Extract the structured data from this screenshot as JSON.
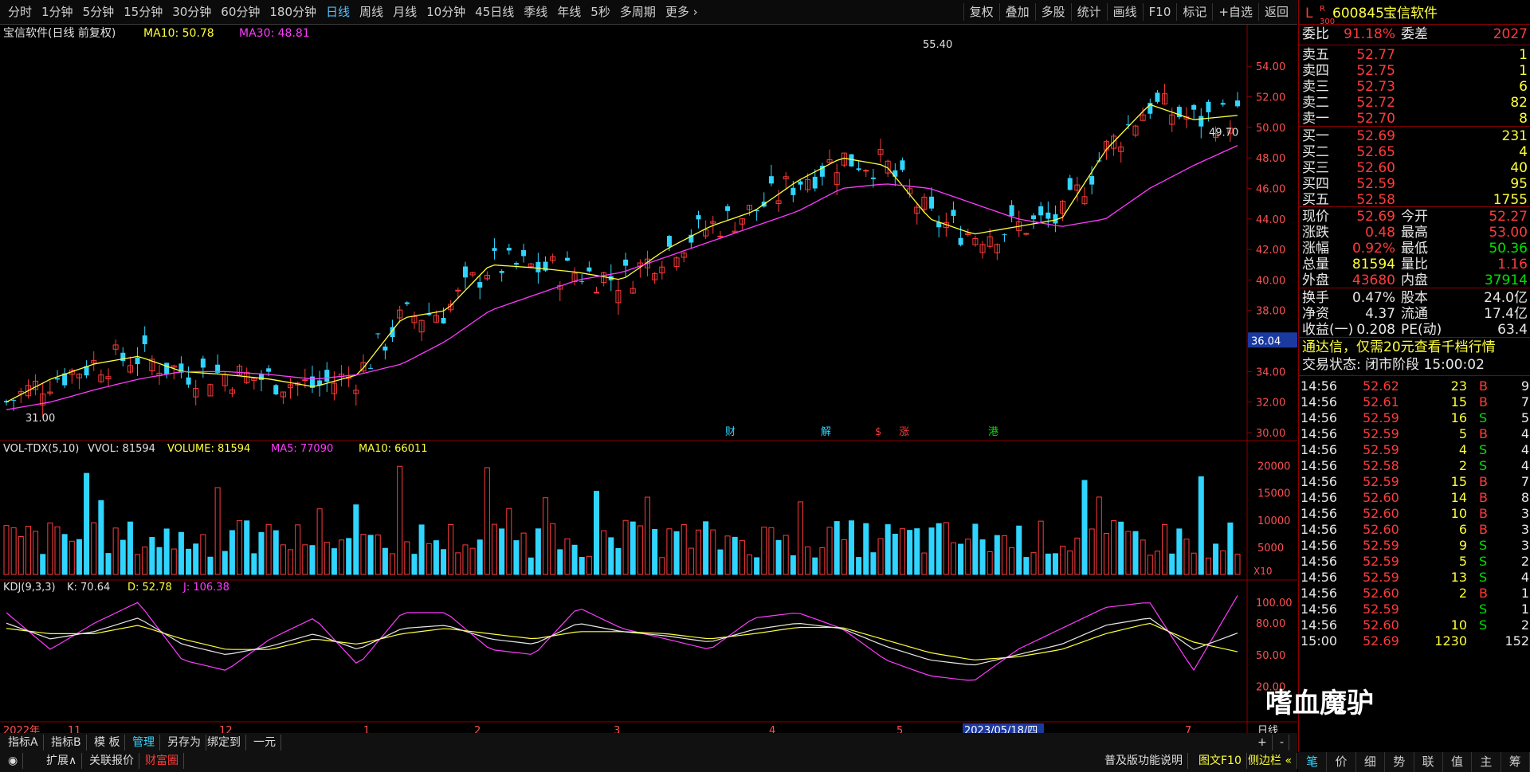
{
  "toolbar": {
    "periods": [
      "分时",
      "1分钟",
      "5分钟",
      "15分钟",
      "30分钟",
      "60分钟",
      "180分钟",
      "日线",
      "周线",
      "月线",
      "10分钟",
      "45日线",
      "季线",
      "年线",
      "5秒",
      "多周期",
      "更多 ›"
    ],
    "active_period": "日线",
    "tools": [
      "复权",
      "叠加",
      "多股",
      "统计",
      "画线",
      "F10",
      "标记",
      "+自选",
      "返回"
    ]
  },
  "main_chart": {
    "title": "宝信软件(日线 前复权)",
    "ma10_label": "MA10: 50.78",
    "ma30_label": "MA30: 48.81",
    "high_marker": "55.40",
    "low_marker": "31.00",
    "price_marker": "49.70",
    "current_tag": "36.04",
    "y_ticks": [
      "54.00",
      "52.00",
      "50.00",
      "48.00",
      "46.00",
      "44.00",
      "42.00",
      "40.00",
      "38.00",
      "36.00",
      "34.00",
      "32.00",
      "30.00"
    ],
    "event_tags": [
      {
        "text": "财",
        "color": "#30d5ff"
      },
      {
        "text": "解",
        "color": "#30d5ff"
      },
      {
        "text": "$",
        "color": "#ff3b3b"
      },
      {
        "text": "涨",
        "color": "#ff3b3b"
      },
      {
        "text": "港",
        "color": "#00e100"
      }
    ]
  },
  "vol_panel": {
    "name": "VOL-TDX(5,10)",
    "vvol": "VVOL: 81594",
    "volume": "VOLUME: 81594",
    "ma5": "MA5: 77090",
    "ma10": "MA10: 66011",
    "y_ticks": [
      "20000",
      "15000",
      "10000",
      "5000"
    ],
    "unit": "X10"
  },
  "kdj_panel": {
    "name": "KDJ(9,3,3)",
    "k": "K: 70.64",
    "d": "D: 52.78",
    "j": "J: 106.38",
    "y_ticks": [
      "100.00",
      "80.00",
      "50.00",
      "20.00"
    ]
  },
  "x_axis": {
    "labels": [
      "2022年",
      "11",
      "12",
      "1",
      "2",
      "3",
      "4",
      "5",
      "2023/05/18/四",
      "7"
    ],
    "period_label": "日线"
  },
  "bottom": {
    "tabs1": [
      "指标A",
      "指标B",
      "模 板",
      "管理",
      "另存为",
      "绑定到",
      "一元"
    ],
    "tabs2": [
      "扩展∧",
      "关联报价",
      "财富圈"
    ],
    "right_links": [
      "普及版功能说明",
      "图文F10",
      "侧边栏 «"
    ],
    "plus": "+",
    "minus": "-"
  },
  "quote": {
    "code": "600845",
    "name": "宝信软件",
    "badge_l": "L",
    "badge_r": "R",
    "badge_num": "300",
    "weibi_label": "委比",
    "weibi": "91.18%",
    "weicha_label": "委差",
    "weicha": "2027",
    "asks": [
      {
        "label": "卖五",
        "price": "52.77",
        "vol": "1"
      },
      {
        "label": "卖四",
        "price": "52.75",
        "vol": "1"
      },
      {
        "label": "卖三",
        "price": "52.73",
        "vol": "6"
      },
      {
        "label": "卖二",
        "price": "52.72",
        "vol": "82"
      },
      {
        "label": "卖一",
        "price": "52.70",
        "vol": "8"
      }
    ],
    "bids": [
      {
        "label": "买一",
        "price": "52.69",
        "vol": "231"
      },
      {
        "label": "买二",
        "price": "52.65",
        "vol": "4"
      },
      {
        "label": "买三",
        "price": "52.60",
        "vol": "40"
      },
      {
        "label": "买四",
        "price": "52.59",
        "vol": "95"
      },
      {
        "label": "买五",
        "price": "52.58",
        "vol": "1755"
      }
    ],
    "stats": [
      {
        "l1": "现价",
        "v1": "52.69",
        "c1": "red",
        "l2": "今开",
        "v2": "52.27",
        "c2": "red"
      },
      {
        "l1": "涨跌",
        "v1": "0.48",
        "c1": "red",
        "l2": "最高",
        "v2": "53.00",
        "c2": "red"
      },
      {
        "l1": "涨幅",
        "v1": "0.92%",
        "c1": "red",
        "l2": "最低",
        "v2": "50.36",
        "c2": "green"
      },
      {
        "l1": "总量",
        "v1": "81594",
        "c1": "yellow",
        "l2": "量比",
        "v2": "1.16",
        "c2": "red"
      },
      {
        "l1": "外盘",
        "v1": "43680",
        "c1": "red",
        "l2": "内盘",
        "v2": "37914",
        "c2": "green"
      }
    ],
    "stats2": [
      {
        "l1": "换手",
        "v1": "0.47%",
        "l2": "股本",
        "v2": "24.0亿"
      },
      {
        "l1": "净资",
        "v1": "4.37",
        "l2": "流通",
        "v2": "17.4亿"
      },
      {
        "l1": "收益(一)",
        "v1": "0.208",
        "l2": "PE(动)",
        "v2": "63.4"
      }
    ],
    "promo": "通达信，仅需20元查看千档行情",
    "status": "交易状态: 闭市阶段 15:00:02"
  },
  "trades": [
    {
      "t": "14:56",
      "p": "52.62",
      "v": "23",
      "s": "B",
      "n": "9"
    },
    {
      "t": "14:56",
      "p": "52.61",
      "v": "15",
      "s": "B",
      "n": "7"
    },
    {
      "t": "14:56",
      "p": "52.59",
      "v": "16",
      "s": "S",
      "n": "5"
    },
    {
      "t": "14:56",
      "p": "52.59",
      "v": "5",
      "s": "B",
      "n": "4"
    },
    {
      "t": "14:56",
      "p": "52.59",
      "v": "4",
      "s": "S",
      "n": "4"
    },
    {
      "t": "14:56",
      "p": "52.58",
      "v": "2",
      "s": "S",
      "n": "4"
    },
    {
      "t": "14:56",
      "p": "52.59",
      "v": "15",
      "s": "B",
      "n": "7"
    },
    {
      "t": "14:56",
      "p": "52.60",
      "v": "14",
      "s": "B",
      "n": "8"
    },
    {
      "t": "14:56",
      "p": "52.60",
      "v": "10",
      "s": "B",
      "n": "3"
    },
    {
      "t": "14:56",
      "p": "52.60",
      "v": "6",
      "s": "B",
      "n": "3"
    },
    {
      "t": "14:56",
      "p": "52.59",
      "v": "9",
      "s": "S",
      "n": "3"
    },
    {
      "t": "14:56",
      "p": "52.59",
      "v": "5",
      "s": "S",
      "n": "2"
    },
    {
      "t": "14:56",
      "p": "52.59",
      "v": "13",
      "s": "S",
      "n": "4"
    },
    {
      "t": "14:56",
      "p": "52.60",
      "v": "2",
      "s": "B",
      "n": "1"
    },
    {
      "t": "14:56",
      "p": "52.59",
      "v": "",
      "s": "S",
      "n": "1"
    },
    {
      "t": "14:56",
      "p": "52.60",
      "v": "10",
      "s": "S",
      "n": "2"
    },
    {
      "t": "15:00",
      "p": "52.69",
      "v": "1230",
      "s": "",
      "n": "152"
    }
  ],
  "right_tabs": [
    "笔",
    "价",
    "细",
    "势",
    "联",
    "值",
    "主",
    "筹"
  ],
  "watermark": "嗜血魔驴",
  "chart_data": {
    "type": "line",
    "title": "宝信软件(日线 前复权)",
    "series": [
      {
        "name": "MA10",
        "values": [
          32.0,
          33.5,
          34.5,
          35.0,
          34.0,
          33.8,
          33.5,
          33.0,
          33.8,
          37.5,
          38.0,
          41.0,
          40.8,
          40.5,
          40.0,
          42.0,
          43.5,
          44.5,
          46.5,
          48.0,
          47.5,
          44.0,
          43.0,
          43.5,
          44.0,
          48.5,
          51.5,
          50.5,
          50.78
        ]
      },
      {
        "name": "MA30",
        "values": [
          31.5,
          32.0,
          32.8,
          33.5,
          34.0,
          34.0,
          33.8,
          33.5,
          33.8,
          34.5,
          36.0,
          38.0,
          39.0,
          40.0,
          40.5,
          41.5,
          42.5,
          43.5,
          44.5,
          46.0,
          46.3,
          46.0,
          45.0,
          44.0,
          43.5,
          44.0,
          46.0,
          47.5,
          48.81
        ]
      }
    ],
    "ylim": [
      30,
      55
    ],
    "grid": false,
    "kdj": {
      "K": [
        80,
        65,
        72,
        85,
        60,
        50,
        58,
        70,
        55,
        75,
        78,
        65,
        60,
        80,
        72,
        68,
        62,
        74,
        80,
        75,
        58,
        45,
        40,
        50,
        60,
        78,
        85,
        55,
        70.64
      ],
      "D": [
        75,
        70,
        70,
        78,
        65,
        55,
        55,
        65,
        60,
        70,
        75,
        70,
        65,
        72,
        72,
        70,
        65,
        70,
        76,
        76,
        64,
        52,
        45,
        48,
        55,
        70,
        80,
        62,
        52.78
      ],
      "J": [
        90,
        55,
        80,
        100,
        45,
        35,
        65,
        85,
        40,
        90,
        90,
        55,
        50,
        95,
        75,
        65,
        55,
        85,
        90,
        75,
        45,
        30,
        25,
        55,
        75,
        95,
        100,
        35,
        106.38
      ]
    }
  }
}
